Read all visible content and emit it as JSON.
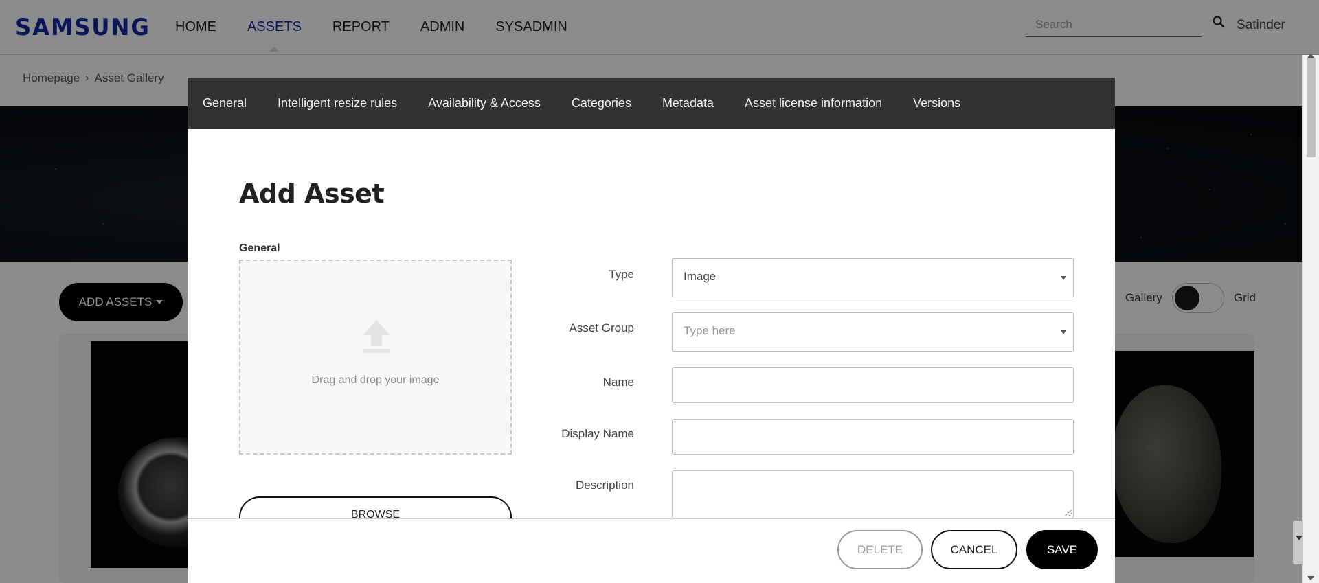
{
  "header": {
    "logo": "SAMSUNG",
    "nav": [
      {
        "label": "HOME",
        "active": false
      },
      {
        "label": "ASSETS",
        "active": true
      },
      {
        "label": "REPORT",
        "active": false
      },
      {
        "label": "ADMIN",
        "active": false
      },
      {
        "label": "SYSADMIN",
        "active": false
      }
    ],
    "search": {
      "placeholder": "Search",
      "icon": "search-icon"
    },
    "user": "Satinder"
  },
  "breadcrumb": {
    "items": [
      "Homepage",
      "Asset Gallery"
    ],
    "separator": "›"
  },
  "gallery": {
    "add_assets_label": "ADD ASSETS",
    "view_toggle": {
      "left_label": "Gallery",
      "right_label": "Grid"
    }
  },
  "modal": {
    "tabs": [
      "General",
      "Intelligent resize rules",
      "Availability & Access",
      "Categories",
      "Metadata",
      "Asset license information",
      "Versions"
    ],
    "title": "Add Asset",
    "section_label": "General",
    "dropzone_text": "Drag and drop your image",
    "browse_label": "BROWSE",
    "form": {
      "type": {
        "label": "Type",
        "value": "Image"
      },
      "asset_group": {
        "label": "Asset Group",
        "placeholder": "Type here"
      },
      "name": {
        "label": "Name",
        "value": ""
      },
      "display_name": {
        "label": "Display Name",
        "value": ""
      },
      "description": {
        "label": "Description",
        "value": ""
      }
    },
    "footer": {
      "delete_label": "DELETE",
      "cancel_label": "CANCEL",
      "save_label": "SAVE"
    }
  },
  "colors": {
    "brand": "#1428a0",
    "modal_tab_bg": "#323232",
    "overlay": "rgba(0,0,0,0.45)",
    "primary_button": "#000000"
  }
}
